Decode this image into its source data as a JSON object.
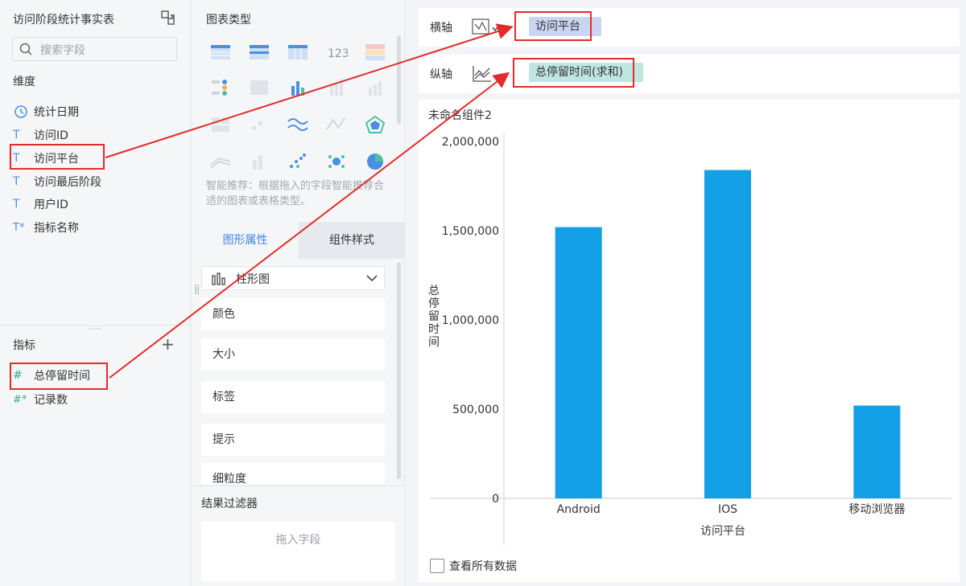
{
  "left_panel": {
    "title": "访问阶段统计事实表",
    "search_placeholder": "搜索字段",
    "dimensions_header": "维度",
    "dimensions": [
      {
        "icon": "clock-icon",
        "glyph": "◷",
        "label": "统计日期"
      },
      {
        "icon": "text-type-icon",
        "glyph": "T",
        "label": "访问ID"
      },
      {
        "icon": "text-type-icon",
        "glyph": "T",
        "label": "访问平台"
      },
      {
        "icon": "text-type-icon",
        "glyph": "T",
        "label": "访问最后阶段"
      },
      {
        "icon": "text-type-icon",
        "glyph": "T",
        "label": "用户ID"
      },
      {
        "icon": "text-calc-type-icon",
        "glyph": "T*",
        "label": "指标名称"
      }
    ],
    "metrics_header": "指标",
    "metrics": [
      {
        "icon": "number-type-icon",
        "glyph": "#",
        "label": "总停留时间"
      },
      {
        "icon": "number-calc-type-icon",
        "glyph": "#*",
        "label": "记录数"
      }
    ]
  },
  "middle_panel": {
    "chart_type_header": "图表类型",
    "hint": "智能推荐：根据拖入的字段智能推荐合适的图表或表格类型。",
    "tabs": [
      "图形属性",
      "组件样式"
    ],
    "chart_select": "柱形图",
    "properties": [
      "颜色",
      "大小",
      "标签",
      "提示",
      "细粒度"
    ],
    "result_filter_label": "结果过滤器",
    "drop_placeholder": "拖入字段"
  },
  "axes": {
    "x_label": "横轴",
    "x_field": "访问平台",
    "y_label": "纵轴",
    "y_field": "总停留时间(求和)"
  },
  "chart_card": {
    "title": "未命名组件2",
    "view_all_label": "查看所有数据"
  },
  "chart_data": {
    "type": "bar",
    "categories": [
      "Android",
      "IOS",
      "移动浏览器"
    ],
    "values": [
      1520000,
      1840000,
      520000
    ],
    "xlabel": "访问平台",
    "ylabel": "总停留时间",
    "ylim": [
      0,
      2000000
    ],
    "yticks": [
      "0",
      "500,000",
      "1,000,000",
      "1,500,000",
      "2,000,000"
    ],
    "bar_color": "#13a0e6",
    "grid": false
  },
  "colors": {
    "accent": "#3d85f0",
    "highlight_border": "#e32b2b",
    "x_pill": "#c8d6f2",
    "y_pill": "#bfe6df"
  }
}
